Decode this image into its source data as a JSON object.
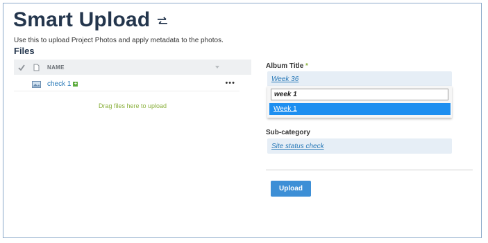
{
  "header": {
    "title": "Smart Upload",
    "swap_icon": "swap-arrows-icon",
    "subtitle": "Use this to upload Project Photos and apply metadata to the photos."
  },
  "files": {
    "title": "Files",
    "columns": {
      "name": "NAME"
    },
    "rows": [
      {
        "name": "check 1",
        "more": "•••"
      }
    ],
    "drop_hint": "Drag files here to upload"
  },
  "form": {
    "album_title": {
      "label": "Album Title",
      "required_marker": "*",
      "selected": "Week 36",
      "search_value": "week 1",
      "options": [
        "Week 1"
      ]
    },
    "subcategory": {
      "label": "Sub-category",
      "selected": "Site status check"
    },
    "upload_label": "Upload"
  },
  "colors": {
    "title": "#24364d",
    "accent": "#3d8fd6",
    "highlight": "#1e8ff0",
    "green": "#8ab03c"
  }
}
